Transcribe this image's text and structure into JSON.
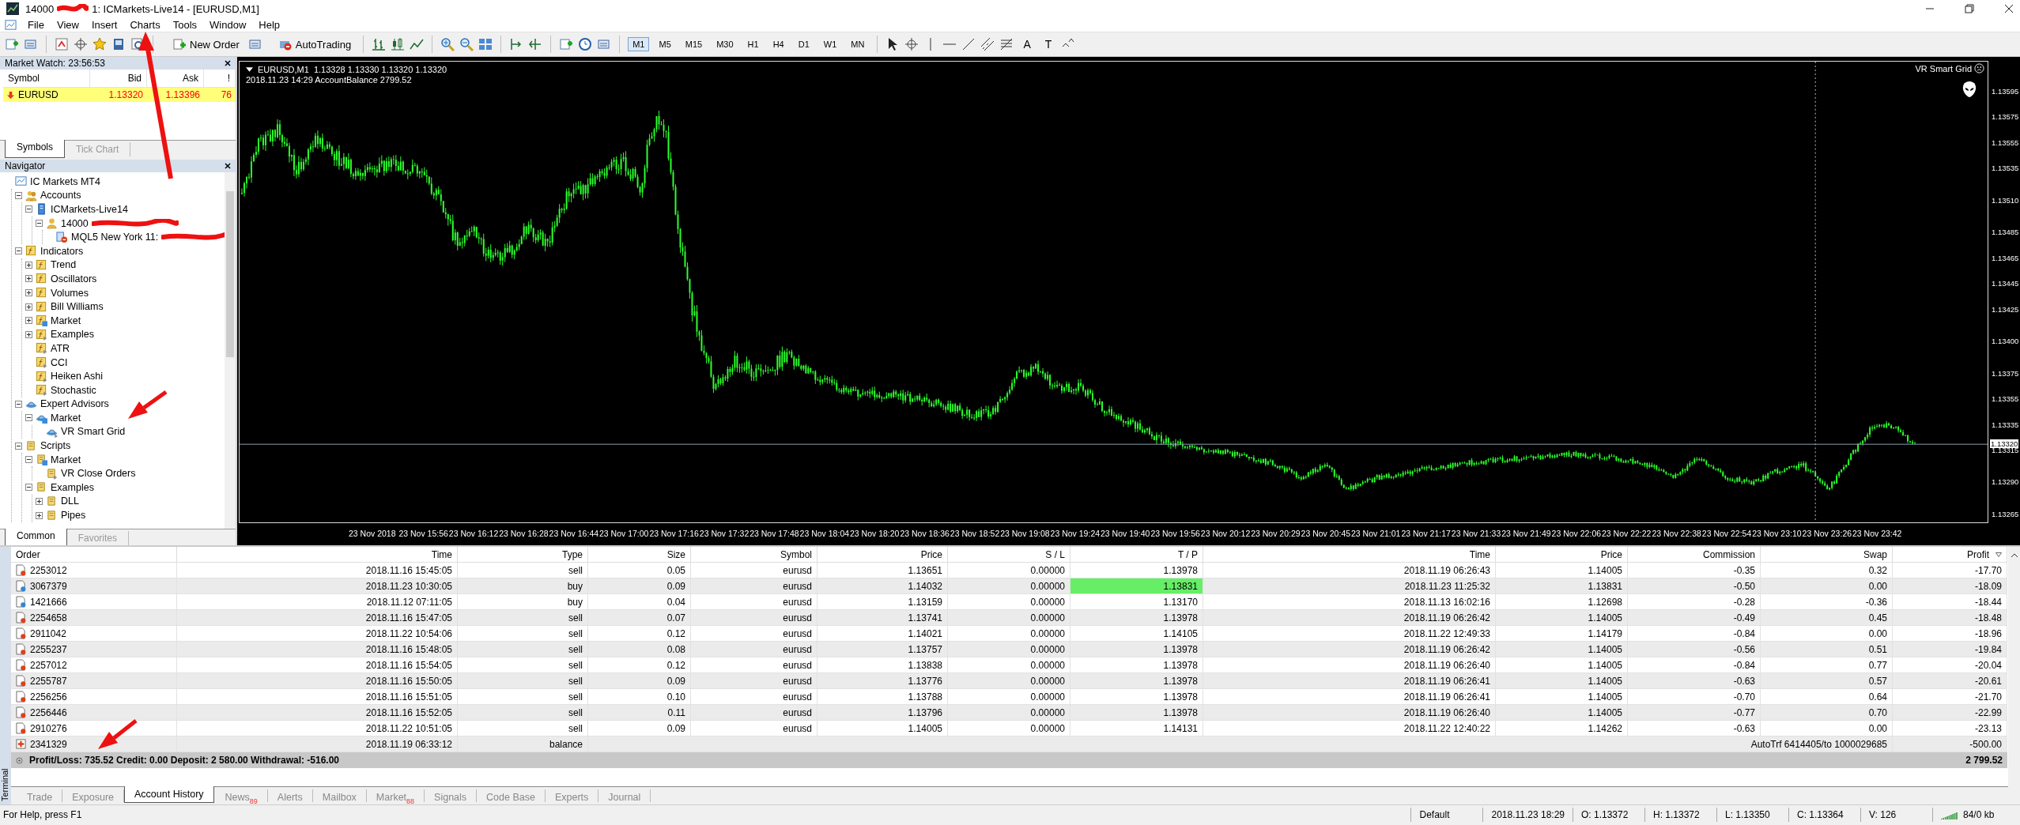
{
  "window": {
    "title_start": "14000",
    "title_end": "1: ICMarkets-Live14 - [EURUSD,M1]",
    "redacted": true
  },
  "menu": [
    "File",
    "View",
    "Insert",
    "Charts",
    "Tools",
    "Window",
    "Help"
  ],
  "toolbar": {
    "new_order": "New Order",
    "autotrading": "AutoTrading",
    "timeframes": [
      {
        "label": "M1",
        "selected": true
      },
      {
        "label": "M5",
        "selected": false
      },
      {
        "label": "M15",
        "selected": false
      },
      {
        "label": "M30",
        "selected": false
      },
      {
        "label": "H1",
        "selected": false
      },
      {
        "label": "H4",
        "selected": false
      },
      {
        "label": "D1",
        "selected": false
      },
      {
        "label": "W1",
        "selected": false
      },
      {
        "label": "MN",
        "selected": false
      }
    ],
    "text_tools": [
      "A",
      "T"
    ]
  },
  "market_watch": {
    "title": "Market Watch: 23:56:53",
    "columns": [
      "Symbol",
      "Bid",
      "Ask",
      "!"
    ],
    "rows": [
      {
        "symbol": "EURUSD",
        "bid": "1.13320",
        "ask": "1.13396",
        "spread": "76",
        "selected": true
      }
    ],
    "tabs": [
      {
        "label": "Symbols",
        "selected": true
      },
      {
        "label": "Tick Chart",
        "selected": false
      }
    ]
  },
  "navigator": {
    "title": "Navigator",
    "tree": [
      {
        "label": "IC Markets MT4",
        "kind": "terminal",
        "children": [
          {
            "label": "Accounts",
            "kind": "accounts",
            "expanded": true,
            "children": [
              {
                "label": "ICMarkets-Live14",
                "kind": "server",
                "expanded": true,
                "children": [
                  {
                    "label": "14000",
                    "kind": "user",
                    "expanded": true,
                    "redacted": true,
                    "children": [
                      {
                        "label": "MQL5 New York 11: ",
                        "kind": "signal",
                        "redacted": true
                      }
                    ]
                  }
                ]
              }
            ]
          },
          {
            "label": "Indicators",
            "kind": "indicator",
            "expanded": true,
            "children": [
              {
                "label": "Trend",
                "kind": "indicator",
                "expanded": false
              },
              {
                "label": "Oscillators",
                "kind": "indicator",
                "expanded": false
              },
              {
                "label": "Volumes",
                "kind": "indicator",
                "expanded": false
              },
              {
                "label": "Bill Williams",
                "kind": "indicator",
                "expanded": false
              },
              {
                "label": "Market",
                "kind": "indicator-market",
                "expanded": false
              },
              {
                "label": "Examples",
                "kind": "indicator-custom",
                "expanded": false
              },
              {
                "label": "ATR",
                "kind": "indicator-custom"
              },
              {
                "label": "CCI",
                "kind": "indicator-custom"
              },
              {
                "label": "Heiken Ashi",
                "kind": "indicator-custom"
              },
              {
                "label": "Stochastic",
                "kind": "indicator-custom"
              }
            ]
          },
          {
            "label": "Expert Advisors",
            "kind": "expert",
            "expanded": true,
            "children": [
              {
                "label": "Market",
                "kind": "expert-market",
                "expanded": true,
                "children": [
                  {
                    "label": "VR Smart Grid",
                    "kind": "expert-custom"
                  }
                ]
              }
            ]
          },
          {
            "label": "Scripts",
            "kind": "script",
            "expanded": true,
            "children": [
              {
                "label": "Market",
                "kind": "script-market",
                "expanded": true,
                "children": [
                  {
                    "label": "VR Close Orders",
                    "kind": "script-custom"
                  }
                ]
              },
              {
                "label": "Examples",
                "kind": "script",
                "expanded": true,
                "children": [
                  {
                    "label": "DLL",
                    "kind": "script",
                    "expanded": false
                  },
                  {
                    "label": "Pipes",
                    "kind": "script",
                    "expanded": false
                  }
                ]
              }
            ]
          }
        ]
      }
    ],
    "tabs": [
      {
        "label": "Common",
        "selected": true
      },
      {
        "label": "Favorites",
        "selected": false
      }
    ]
  },
  "chart": {
    "symbol_line": "EURUSD,M1  1.13328 1.13330 1.13320 1.13320",
    "info_line": "2018.11.23 14:29 AccountBalance 2799.52",
    "expert_name": "VR Smart Grid",
    "price_ticks": [
      "1.13595",
      "1.13575",
      "1.13555",
      "1.13535",
      "1.13510",
      "1.13485",
      "1.13465",
      "1.13445",
      "1.13425",
      "1.13400",
      "1.13375",
      "1.13355",
      "1.13335",
      "1.13315",
      "1.13290",
      "1.13265"
    ],
    "bid_label": "1.13320",
    "time_labels": [
      "23 Nov 2018",
      "23 Nov 15:56",
      "23 Nov 16:12",
      "23 Nov 16:28",
      "23 Nov 16:44",
      "23 Nov 17:00",
      "23 Nov 17:16",
      "23 Nov 17:32",
      "23 Nov 17:48",
      "23 Nov 18:04",
      "23 Nov 18:20",
      "23 Nov 18:36",
      "23 Nov 18:52",
      "23 Nov 19:08",
      "23 Nov 19:24",
      "23 Nov 19:40",
      "23 Nov 19:56",
      "23 Nov 20:12",
      "23 Nov 20:29",
      "23 Nov 20:45",
      "23 Nov 21:01",
      "23 Nov 21:17",
      "23 Nov 21:33",
      "23 Nov 21:49",
      "23 Nov 22:06",
      "23 Nov 22:22",
      "23 Nov 22:38",
      "23 Nov 22:54",
      "23 Nov 23:10",
      "23 Nov 23:26",
      "23 Nov 23:42"
    ]
  },
  "terminal": {
    "side_label": "Terminal",
    "columns": [
      "Order",
      "Time",
      "Type",
      "Size",
      "Symbol",
      "Price",
      "S / L",
      "T / P",
      "Time",
      "Price",
      "Commission",
      "Swap",
      "Profit"
    ],
    "rows": [
      {
        "kind": "trade",
        "color": "#e0401a",
        "order": "2253012",
        "time": "2018.11.16 15:45:05",
        "type": "sell",
        "size": "0.05",
        "symbol": "eurusd",
        "price": "1.13651",
        "sl": "0.00000",
        "tp": "1.13978",
        "tp_hit": false,
        "close_time": "2018.11.19 06:26:43",
        "close_price": "1.14005",
        "commission": "-0.35",
        "swap": "0.32",
        "profit": "-17.70"
      },
      {
        "kind": "trade",
        "color": "#2f86d8",
        "order": "3067379",
        "time": "2018.11.23 10:30:05",
        "type": "buy",
        "size": "0.09",
        "symbol": "eurusd",
        "price": "1.14032",
        "sl": "0.00000",
        "tp": "1.13831",
        "tp_hit": true,
        "close_time": "2018.11.23 11:25:32",
        "close_price": "1.13831",
        "commission": "-0.50",
        "swap": "0.00",
        "profit": "-18.09"
      },
      {
        "kind": "trade",
        "color": "#2f86d8",
        "order": "1421666",
        "time": "2018.11.12 07:11:05",
        "type": "buy",
        "size": "0.04",
        "symbol": "eurusd",
        "price": "1.13159",
        "sl": "0.00000",
        "tp": "1.13170",
        "tp_hit": false,
        "close_time": "2018.11.13 16:02:16",
        "close_price": "1.12698",
        "commission": "-0.28",
        "swap": "-0.36",
        "profit": "-18.44"
      },
      {
        "kind": "trade",
        "color": "#e0401a",
        "order": "2254658",
        "time": "2018.11.16 15:47:05",
        "type": "sell",
        "size": "0.07",
        "symbol": "eurusd",
        "price": "1.13741",
        "sl": "0.00000",
        "tp": "1.13978",
        "tp_hit": false,
        "close_time": "2018.11.19 06:26:42",
        "close_price": "1.14005",
        "commission": "-0.49",
        "swap": "0.45",
        "profit": "-18.48"
      },
      {
        "kind": "trade",
        "color": "#e0401a",
        "order": "2911042",
        "time": "2018.11.22 10:54:06",
        "type": "sell",
        "size": "0.12",
        "symbol": "eurusd",
        "price": "1.14021",
        "sl": "0.00000",
        "tp": "1.14105",
        "tp_hit": false,
        "close_time": "2018.11.22 12:49:33",
        "close_price": "1.14179",
        "commission": "-0.84",
        "swap": "0.00",
        "profit": "-18.96"
      },
      {
        "kind": "trade",
        "color": "#e0401a",
        "order": "2255237",
        "time": "2018.11.16 15:48:05",
        "type": "sell",
        "size": "0.08",
        "symbol": "eurusd",
        "price": "1.13757",
        "sl": "0.00000",
        "tp": "1.13978",
        "tp_hit": false,
        "close_time": "2018.11.19 06:26:42",
        "close_price": "1.14005",
        "commission": "-0.56",
        "swap": "0.51",
        "profit": "-19.84"
      },
      {
        "kind": "trade",
        "color": "#e0401a",
        "order": "2257012",
        "time": "2018.11.16 15:54:05",
        "type": "sell",
        "size": "0.12",
        "symbol": "eurusd",
        "price": "1.13838",
        "sl": "0.00000",
        "tp": "1.13978",
        "tp_hit": false,
        "close_time": "2018.11.19 06:26:40",
        "close_price": "1.14005",
        "commission": "-0.84",
        "swap": "0.77",
        "profit": "-20.04"
      },
      {
        "kind": "trade",
        "color": "#e0401a",
        "order": "2255787",
        "time": "2018.11.16 15:50:05",
        "type": "sell",
        "size": "0.09",
        "symbol": "eurusd",
        "price": "1.13776",
        "sl": "0.00000",
        "tp": "1.13978",
        "tp_hit": false,
        "close_time": "2018.11.19 06:26:41",
        "close_price": "1.14005",
        "commission": "-0.63",
        "swap": "0.57",
        "profit": "-20.61"
      },
      {
        "kind": "trade",
        "color": "#e0401a",
        "order": "2256256",
        "time": "2018.11.16 15:51:05",
        "type": "sell",
        "size": "0.10",
        "symbol": "eurusd",
        "price": "1.13788",
        "sl": "0.00000",
        "tp": "1.13978",
        "tp_hit": false,
        "close_time": "2018.11.19 06:26:41",
        "close_price": "1.14005",
        "commission": "-0.70",
        "swap": "0.64",
        "profit": "-21.70"
      },
      {
        "kind": "trade",
        "color": "#e0401a",
        "order": "2256446",
        "time": "2018.11.16 15:52:05",
        "type": "sell",
        "size": "0.11",
        "symbol": "eurusd",
        "price": "1.13796",
        "sl": "0.00000",
        "tp": "1.13978",
        "tp_hit": false,
        "close_time": "2018.11.19 06:26:40",
        "close_price": "1.14005",
        "commission": "-0.77",
        "swap": "0.70",
        "profit": "-22.99"
      },
      {
        "kind": "trade",
        "color": "#e0401a",
        "order": "2910276",
        "time": "2018.11.22 10:51:05",
        "type": "sell",
        "size": "0.09",
        "symbol": "eurusd",
        "price": "1.14005",
        "sl": "0.00000",
        "tp": "1.14131",
        "tp_hit": false,
        "close_time": "2018.11.22 12:40:22",
        "close_price": "1.14262",
        "commission": "-0.63",
        "swap": "0.00",
        "profit": "-23.13"
      },
      {
        "kind": "balance",
        "order": "2341329",
        "time": "2018.11.19 06:33:12",
        "type": "balance",
        "comment": "AutoTrf 6414405/to 1000029685",
        "profit": "-500.00"
      }
    ],
    "summary": {
      "text": "Profit/Loss: 735.52  Credit: 0.00  Deposit: 2 580.00  Withdrawal: -516.00",
      "total": "2 799.52"
    },
    "tabs": [
      {
        "label": "Trade",
        "selected": false
      },
      {
        "label": "Exposure",
        "selected": false
      },
      {
        "label": "Account History",
        "selected": true
      },
      {
        "label": "News",
        "badge": "89",
        "selected": false
      },
      {
        "label": "Alerts",
        "selected": false
      },
      {
        "label": "Mailbox",
        "selected": false
      },
      {
        "label": "Market",
        "badge": "88",
        "selected": false
      },
      {
        "label": "Signals",
        "selected": false
      },
      {
        "label": "Code Base",
        "selected": false
      },
      {
        "label": "Experts",
        "selected": false
      },
      {
        "label": "Journal",
        "selected": false
      }
    ]
  },
  "status_bar": {
    "help": "For Help, press F1",
    "cells": [
      "Default",
      "2018.11.23 18:29",
      "O: 1.13372",
      "H: 1.13372",
      "L: 1.13350",
      "C: 1.13364",
      "V: 126"
    ],
    "traffic": "84/0 kb"
  }
}
